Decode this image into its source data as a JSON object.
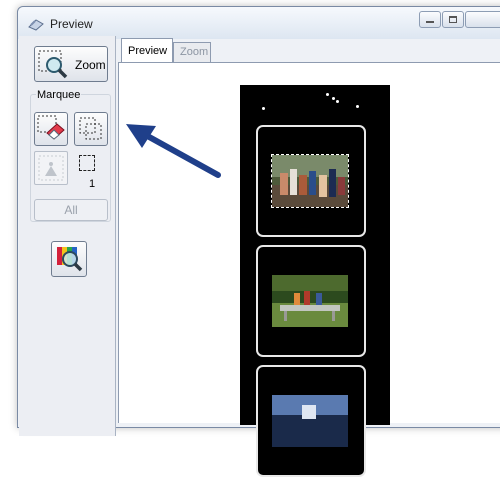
{
  "window": {
    "title": "Preview"
  },
  "left_panel": {
    "zoom_button_label": "Zoom",
    "marquee_group_label": "Marquee",
    "marquee_count": "1",
    "all_button_label": "All"
  },
  "tabs": [
    {
      "label": "Preview",
      "active": true
    },
    {
      "label": "Zoom",
      "active": false
    }
  ],
  "icons": {
    "app": "scanner-app-icon",
    "zoom": "zoom-marquee-icon",
    "erase": "erase-marquee-icon",
    "copy": "copy-marquee-icon",
    "exposure": "auto-exposure-icon",
    "thumbnail": "thumbnail-view-icon",
    "annotation": "pointer-arrow"
  },
  "colors": {
    "annotation_arrow": "#1f3f8a",
    "film_strip": "#000000",
    "frame_border": "#e8e8e8"
  }
}
